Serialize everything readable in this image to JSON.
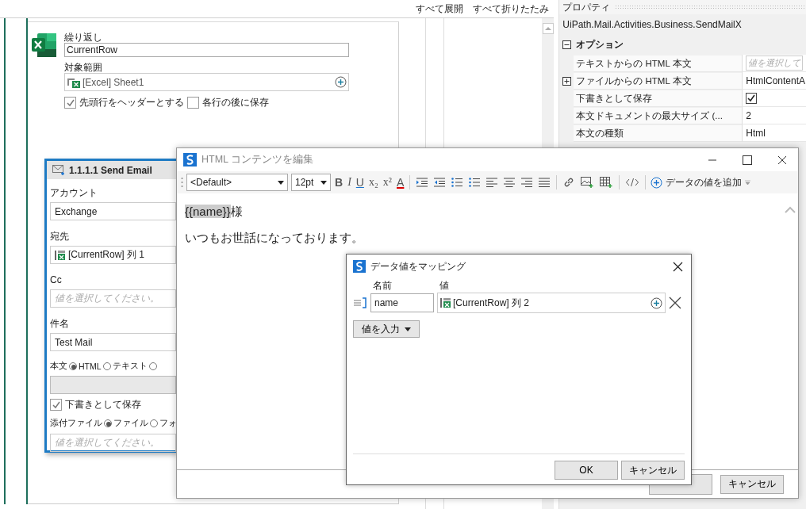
{
  "top_bar": {
    "expand_all": "すべて展開",
    "collapse_all": "すべて折りたたみ"
  },
  "for_each_row": {
    "loop_label": "繰り返し",
    "loop_value": "CurrentRow",
    "range_label": "対象範囲",
    "range_value": "[Excel] Sheet1",
    "options": [
      {
        "label": "先頭行をヘッダーとする",
        "checked": true
      },
      {
        "label": "各行の後に保存",
        "checked": false
      }
    ]
  },
  "properties": {
    "title": "プロパティ",
    "class_name": "UiPath.Mail.Activities.Business.SendMailX",
    "category": {
      "label": "オプション",
      "expanded": true
    },
    "rows": [
      {
        "label": "テキストからの HTML 本文",
        "kind": "placeholder",
        "placeholder": "値を選択して",
        "expandable": false
      },
      {
        "label": "ファイルからの HTML 本文",
        "kind": "text",
        "value": "HtmlContentA",
        "expandable": true
      },
      {
        "label": "下書きとして保存",
        "kind": "checkbox",
        "checked": true,
        "expandable": false
      },
      {
        "label": "本文ドキュメントの最大サイズ (...",
        "kind": "text",
        "value": "2",
        "expandable": false
      },
      {
        "label": "本文の種類",
        "kind": "text",
        "value": "Html",
        "expandable": false
      }
    ]
  },
  "send_email": {
    "title": "1.1.1.1 Send Email",
    "fields": [
      {
        "label": "アカウント",
        "kind": "value",
        "value": "Exchange"
      },
      {
        "label": "宛先",
        "kind": "column",
        "value": "[CurrentRow] 列 1"
      },
      {
        "label": "Cc",
        "kind": "placeholder",
        "placeholder": "値を選択してください。"
      },
      {
        "label": "件名",
        "kind": "value",
        "value": "Test Mail"
      }
    ],
    "body": {
      "label": "本文",
      "options": [
        {
          "label": "HTML",
          "selected": true
        },
        {
          "label": "テキスト",
          "selected": false
        },
        {
          "selected": false
        }
      ]
    },
    "save_draft": {
      "label": "下書きとして保存",
      "checked": true
    },
    "attachments": {
      "label": "添付ファイル",
      "options": [
        {
          "label": "ファイル",
          "selected": true
        },
        {
          "label": "フォ",
          "selected": false
        }
      ],
      "placeholder": "値を選択してください。"
    }
  },
  "editor": {
    "title": "HTML コンテンツを編集",
    "font": "<Default>",
    "size": "12pt",
    "format_buttons": [
      {
        "kind": "bold",
        "glyph": "B"
      },
      {
        "kind": "italic",
        "glyph": "I"
      },
      {
        "kind": "underline",
        "glyph": "U"
      },
      {
        "kind": "subscript",
        "glyph": "x₂"
      },
      {
        "kind": "superscript",
        "glyph": "x²"
      },
      {
        "kind": "color",
        "glyph": "A"
      }
    ],
    "add_data_value": "データの値を追加",
    "content": [
      {
        "token": "{{name}}",
        "text": "様"
      },
      {
        "text": "いつもお世話になっております。"
      }
    ],
    "cancel": "キャンセル"
  },
  "mapping_dialog": {
    "title": "データ値をマッピング",
    "name_header": "名前",
    "value_header": "値",
    "rows": [
      {
        "name": "name",
        "value": "[CurrentRow] 列 2"
      }
    ],
    "enter_value": "値を入力",
    "ok": "OK",
    "cancel": "キャンセル"
  }
}
